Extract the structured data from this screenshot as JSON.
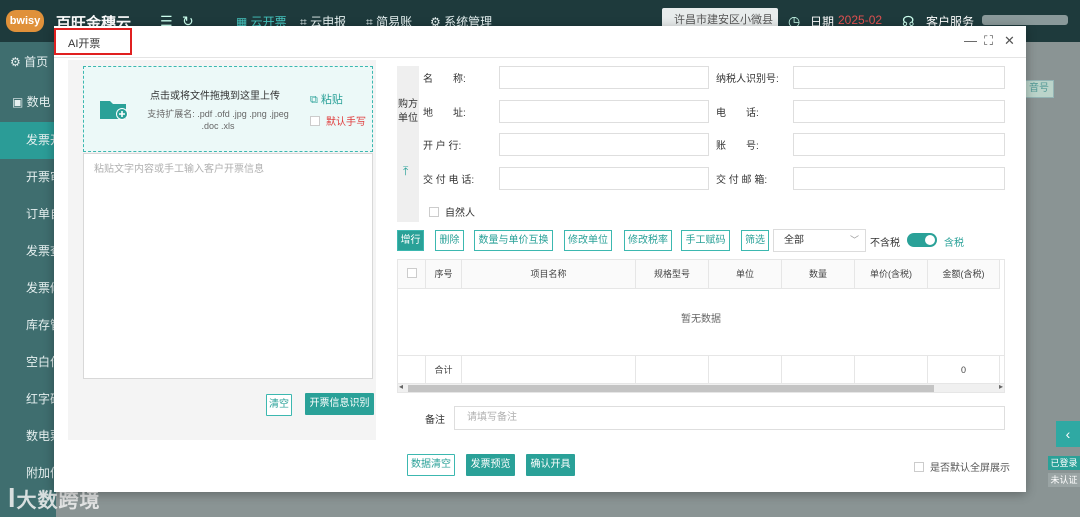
{
  "app": {
    "logo_text": "bwisy",
    "brand": "百旺金穗云",
    "nav": [
      "云开票",
      "云申报",
      "简易账",
      "系统管理"
    ],
    "org_selector": "许昌市建安区小微县",
    "date_label": "日期",
    "date_value": "2025-02",
    "customer_service": "客户服务",
    "sidebar": [
      "首页",
      "数电",
      "发票开",
      "开票审",
      "订单自",
      "发票查",
      "发票修",
      "库存管",
      "空白作",
      "红字确",
      "数电票",
      "附加信"
    ],
    "badges": [
      "已登录",
      "未认证"
    ],
    "bg_tag": "音号",
    "watermark": "大数跨境",
    "colors": {
      "accent": "#2aa198",
      "topbar": "#1e3a3c",
      "sidebar": "#3f6e6f",
      "danger": "#e02020"
    }
  },
  "modal": {
    "title": "AI开票",
    "left": {
      "upload_main": "点击或将文件拖拽到这里上传",
      "upload_sub": "支持扩展名: .pdf .ofd .jpg .png .jpeg .doc .xls",
      "paste_label": "粘贴",
      "manual_label": "默认手写",
      "textarea_placeholder": "粘贴文字内容或手工输入客户开票信息",
      "clear_label": "清空",
      "recognize_label": "开票信息识别"
    },
    "buyer": {
      "section_label": "购方单位",
      "fields": {
        "name": "名　　称:",
        "tax_id": "纳税人识别号:",
        "address": "地　　址:",
        "phone": "电　　话:",
        "bank": "开 户 行:",
        "account": "账　　号:",
        "delivery_phone": "交 付 电 话:",
        "delivery_email": "交 付 邮 箱:"
      },
      "natural_person": "自然人"
    },
    "toolbar": {
      "add_row": "增行",
      "delete": "删除",
      "swap": "数量与单价互换",
      "edit_unit": "修改单位",
      "edit_rate": "修改税率",
      "manual_code": "手工赋码",
      "filter": "筛选",
      "filter_value": "全部",
      "tax_excluded": "不含税",
      "tax_included": "含税"
    },
    "table": {
      "headers": [
        "序号",
        "项目名称",
        "规格型号",
        "单位",
        "数量",
        "单价(含税)",
        "金额(含税)"
      ],
      "empty_text": "暂无数据",
      "sum_label": "合计",
      "sum_amount": "0"
    },
    "remark_label": "备注",
    "remark_placeholder": "请填写备注",
    "footer": {
      "clear_data": "数据清空",
      "preview": "发票预览",
      "confirm": "确认开具",
      "fullscreen_label": "是否默认全屏展示"
    }
  }
}
